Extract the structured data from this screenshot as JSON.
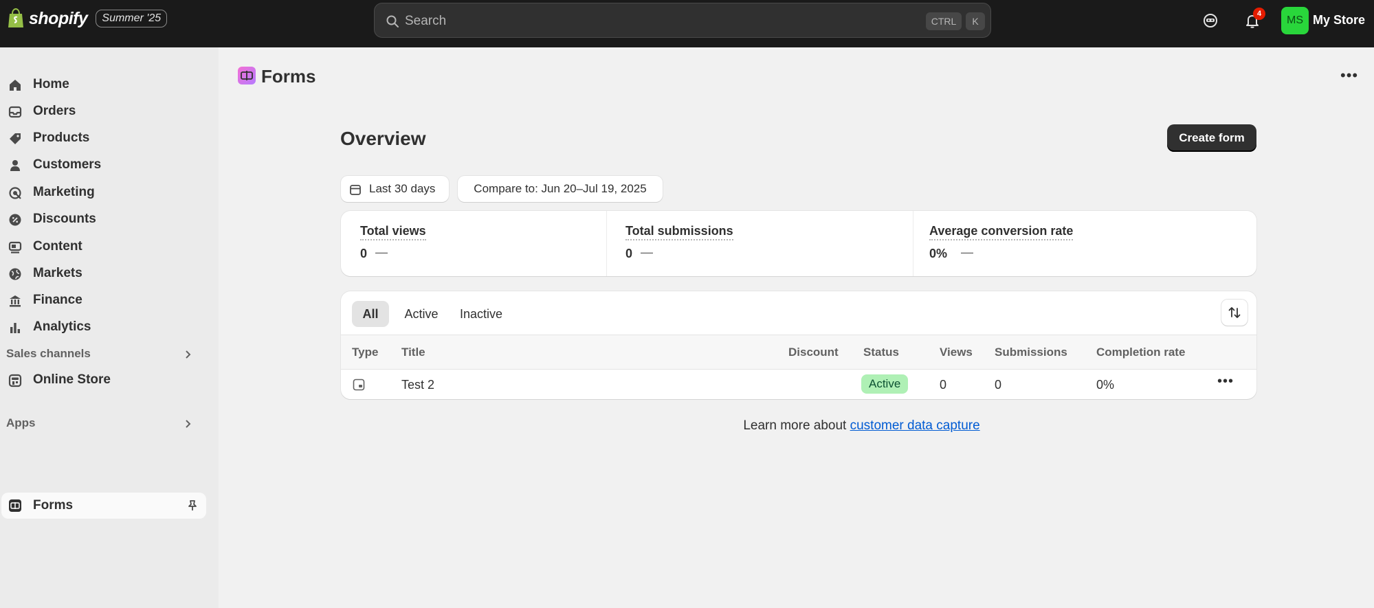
{
  "topbar": {
    "brand": "shopify",
    "edition": "Summer '25",
    "search_placeholder": "Search",
    "shortcut_ctrl": "CTRL",
    "shortcut_k": "K",
    "notification_count": "4",
    "avatar_initials": "MS",
    "store_name": "My Store"
  },
  "sidebar": {
    "items": [
      {
        "label": "Home",
        "icon": "home-icon"
      },
      {
        "label": "Orders",
        "icon": "inbox-icon"
      },
      {
        "label": "Products",
        "icon": "tag-icon"
      },
      {
        "label": "Customers",
        "icon": "person-icon"
      },
      {
        "label": "Marketing",
        "icon": "target-icon"
      },
      {
        "label": "Discounts",
        "icon": "discount-icon"
      },
      {
        "label": "Content",
        "icon": "content-icon"
      },
      {
        "label": "Markets",
        "icon": "globe-icon"
      },
      {
        "label": "Finance",
        "icon": "bank-icon"
      },
      {
        "label": "Analytics",
        "icon": "bar-chart-icon"
      }
    ],
    "sales_channels_label": "Sales channels",
    "online_store_label": "Online Store",
    "apps_label": "Apps",
    "forms_label": "Forms"
  },
  "page": {
    "title": "Forms",
    "overview_title": "Overview",
    "create_button": "Create form",
    "date_range": "Last 30 days",
    "compare": "Compare to: Jun 20–Jul 19, 2025"
  },
  "metrics": [
    {
      "label": "Total views",
      "value": "0",
      "trend": "—"
    },
    {
      "label": "Total submissions",
      "value": "0",
      "trend": "—"
    },
    {
      "label": "Average conversion rate",
      "value": "0%",
      "trend": "—"
    }
  ],
  "table": {
    "tabs": [
      "All",
      "Active",
      "Inactive"
    ],
    "headers": [
      "Type",
      "Title",
      "Discount",
      "Status",
      "Views",
      "Submissions",
      "Completion rate"
    ],
    "rows": [
      {
        "title": "Test 2",
        "discount": "",
        "status": "Active",
        "views": "0",
        "submissions": "0",
        "completion_rate": "0%"
      }
    ]
  },
  "footer": {
    "learn_text": "Learn more about ",
    "learn_link": "customer data capture"
  },
  "colors": {
    "topbar": "#1a1a1a",
    "accent_primary_button": "#303030",
    "status_active_bg": "#aff0b5",
    "link": "#005bd3",
    "avatar": "#29d63b",
    "badge": "#e51c00"
  }
}
